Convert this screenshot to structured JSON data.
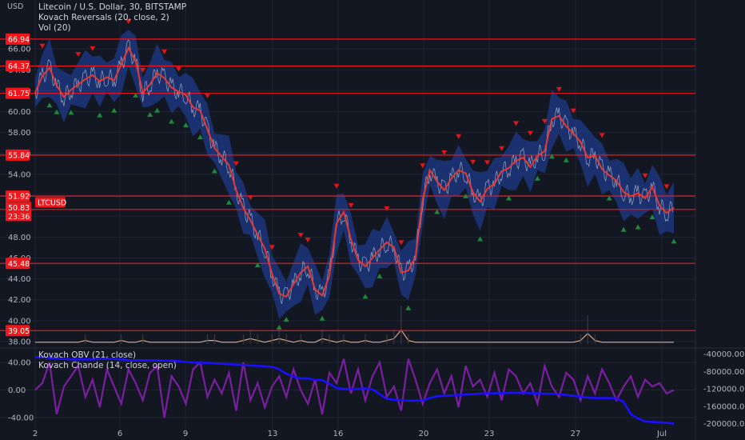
{
  "title": "Litecoin / U.S. Dollar, 30, BITSTAMP",
  "indicator_1": "Kovach Reversals (20, close, 2)",
  "indicator_2": "Vol (20)",
  "pane_indicator_1": "Kovach OBV (21, close)",
  "pane_indicator_2": "Kovach Chande (14, close, open)",
  "currency": "USD",
  "current_symbol": "LTCUSD",
  "current_price": "50.83",
  "countdown": "23:36",
  "colors": {
    "background": "#131722",
    "level_line": "#f0161b",
    "tag": "#f0161b",
    "band": "#1e3a8a",
    "price": "#c8ccd6",
    "ma": "#e53935",
    "reversal_up": "#1b8a3a",
    "reversal_down": "#e0161b",
    "obv": "#1a10ff",
    "chande": "#7b1fa2",
    "volume": "#d8a890"
  },
  "chart_data": [
    {
      "type": "line",
      "ylim": [
        38,
        68
      ],
      "y_ticks": [
        "38.00",
        "40.00",
        "42.00",
        "44.00",
        "46.00",
        "48.00",
        "50.00",
        "52.00",
        "54.00",
        "56.00",
        "58.00",
        "60.00",
        "62.00",
        "64.00",
        "66.00"
      ],
      "x_ticks": [
        "2",
        "6",
        "9",
        "13",
        "16",
        "20",
        "23",
        "27",
        "Jul"
      ],
      "levels": [
        "66.94",
        "64.37",
        "61.75",
        "55.84",
        "51.92",
        "50.64",
        "45.48",
        "39.05"
      ],
      "series": [
        {
          "values": [
            61.8,
            63.4,
            64.2,
            62.5,
            61.4,
            62.1,
            62.6,
            63.1,
            63.5,
            62.9,
            63.3,
            63.0,
            64.5,
            66.1,
            64.8,
            61.8,
            62.6,
            63.7,
            63.2,
            62.3,
            61.9,
            61.6,
            60.4,
            60.1,
            58.3,
            56.5,
            55.7,
            54.9,
            52.5,
            50.8,
            49.6,
            48.2,
            46.9,
            44.5,
            42.6,
            42.3,
            43.5,
            44.6,
            45.2,
            43.0,
            42.4,
            44.3,
            49.3,
            50.4,
            47.8,
            45.8,
            45.2,
            46.0,
            46.8,
            47.5,
            47.0,
            44.6,
            44.8,
            46.1,
            51.6,
            54.4,
            53.3,
            52.5,
            53.6,
            54.4,
            54.1,
            52.3,
            51.4,
            52.6,
            53.1,
            54.3,
            54.6,
            55.3,
            55.6,
            54.7,
            55.8,
            56.2,
            59.3,
            59.6,
            58.6,
            57.9,
            57.1,
            55.6,
            55.8,
            54.5,
            53.9,
            53.4,
            52.3,
            51.9,
            52.2,
            51.7,
            52.8,
            51.0,
            50.3,
            50.83
          ]
        }
      ],
      "reversal_markers": {
        "up": [
          2,
          3,
          5,
          9,
          11,
          14,
          16,
          17,
          19,
          21,
          23,
          25,
          27,
          31,
          34,
          35,
          40,
          46,
          48,
          52,
          56,
          60,
          62,
          66,
          70,
          72,
          74,
          80,
          82,
          84,
          86,
          89
        ],
        "down": [
          1,
          6,
          8,
          13,
          15,
          18,
          20,
          24,
          28,
          30,
          33,
          37,
          38,
          42,
          44,
          49,
          51,
          54,
          57,
          59,
          61,
          63,
          65,
          67,
          69,
          71,
          73,
          75,
          79,
          85,
          88
        ]
      },
      "volume": [
        1,
        1,
        1,
        1,
        1,
        1,
        1,
        2,
        1,
        1,
        1,
        1,
        2,
        1,
        1,
        2,
        1,
        1,
        1,
        1,
        1,
        1,
        1,
        1,
        2,
        2,
        1,
        1,
        1,
        2,
        3,
        2,
        1,
        2,
        3,
        2,
        1,
        2,
        1,
        1,
        3,
        2,
        1,
        2,
        1,
        1,
        2,
        1,
        1,
        2,
        3,
        8,
        2,
        1,
        1,
        1,
        1,
        1,
        1,
        1,
        1,
        1,
        1,
        1,
        1,
        1,
        1,
        1,
        1,
        1,
        1,
        1,
        1,
        1,
        1,
        1,
        2,
        6,
        2,
        1,
        1,
        1,
        1,
        1,
        1,
        1,
        1,
        1,
        1,
        1
      ]
    },
    {
      "type": "line",
      "ylim": [
        -55,
        55
      ],
      "y_ticks": [
        "40.00",
        "0.00",
        "-40.00"
      ],
      "right_ticks": [
        "-40000.00",
        "-80000.00",
        "-120000.00",
        "-160000.00",
        "-200000.00"
      ],
      "right_ylim": [
        -210000,
        -35000
      ],
      "series": [
        {
          "values": [
            -47000,
            -47000,
            -49000,
            -50000,
            -51000,
            -52000,
            -52000,
            -52000,
            -52000,
            -51000,
            -51000,
            -51000,
            -52000,
            -54000,
            -54000,
            -54000,
            -54000,
            -54000,
            -55000,
            -55000,
            -56000,
            -58000,
            -59000,
            -60000,
            -60000,
            -61000,
            -62000,
            -63000,
            -64000,
            -65000,
            -66000,
            -67000,
            -68000,
            -69000,
            -75000,
            -85000,
            -92000,
            -96000,
            -96000,
            -99000,
            -100000,
            -108000,
            -118000,
            -120000,
            -120000,
            -120000,
            -119000,
            -121000,
            -132000,
            -143000,
            -145000,
            -146000,
            -147000,
            -147000,
            -147000,
            -141000,
            -137000,
            -136000,
            -135000,
            -134000,
            -133000,
            -132000,
            -131000,
            -130000,
            -130000,
            -130000,
            -129000,
            -129000,
            -129000,
            -130000,
            -130000,
            -131000,
            -131000,
            -132000,
            -134000,
            -136000,
            -138000,
            -140000,
            -141000,
            -141000,
            -141000,
            -142000,
            -150000,
            -178000,
            -188000,
            -195000,
            -196000,
            -197000,
            -198000,
            -200000
          ]
        },
        {
          "values": [
            0,
            10,
            40,
            -35,
            5,
            20,
            35,
            -10,
            15,
            -25,
            30,
            5,
            -20,
            30,
            10,
            -15,
            25,
            35,
            -40,
            20,
            5,
            -20,
            30,
            40,
            -10,
            15,
            -5,
            25,
            -30,
            40,
            -15,
            10,
            -25,
            5,
            20,
            -10,
            30,
            0,
            -20,
            15,
            -35,
            25,
            10,
            45,
            -5,
            30,
            -15,
            20,
            40,
            -10,
            5,
            -30,
            45,
            15,
            -20,
            10,
            30,
            -5,
            20,
            -25,
            35,
            5,
            15,
            -10,
            25,
            -15,
            30,
            20,
            -5,
            10,
            -20,
            35,
            5,
            -10,
            25,
            15,
            -15,
            20,
            -5,
            30,
            10,
            -15,
            5,
            20,
            -10,
            15,
            5,
            10,
            -5,
            0
          ]
        }
      ]
    }
  ]
}
